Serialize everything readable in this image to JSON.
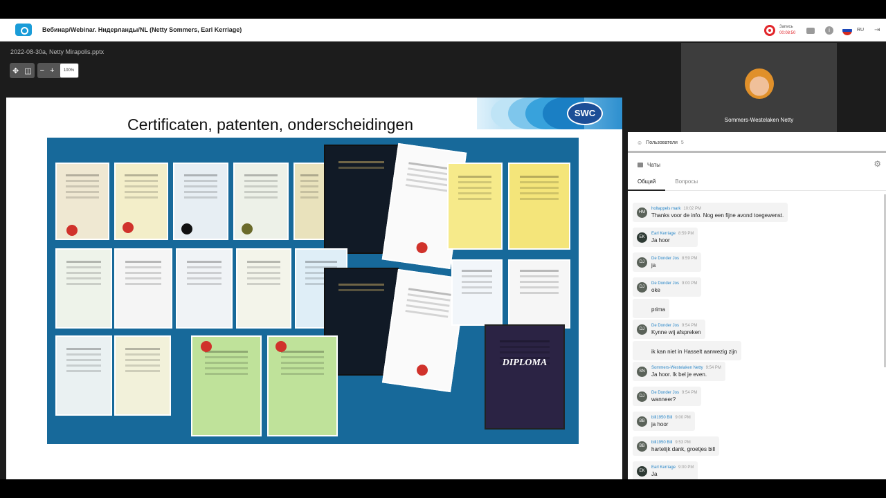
{
  "topbar": {
    "title": "Вебинар/Webinar. Нидерланды/NL (Netty Sommers, Earl Kerriage)",
    "record_label": "Запись",
    "record_time": "00:08:50",
    "language": "RU",
    "accent_color": "#1a9cd8",
    "record_color": "#e2262b",
    "icons": [
      "logo-icon",
      "record-icon",
      "folder-icon",
      "info-icon",
      "flag-ru-icon",
      "exit-icon"
    ]
  },
  "presentation": {
    "filename": "2022-08-30a, Netty Mirapolis.pptx",
    "zoom": "100%",
    "slide_title": "Certificaten, patenten, onderscheidingen",
    "logo_text": "SWC",
    "diploma_text": "DIPLOMA"
  },
  "video": {
    "participant_name": "Sommers-Westelaken Netty"
  },
  "users": {
    "label": "Пользователи",
    "count": "5"
  },
  "chats": {
    "title": "Чаты",
    "tabs": [
      "Общий",
      "Вопросы"
    ],
    "active_tab": 0,
    "messages": [
      {
        "initials": "HM",
        "author": "holtappels mark",
        "time": "10:02 PM",
        "text": "Thanks voor de info. Nog een fijne avond toegewenst."
      },
      {
        "initials": "EK",
        "author": "Earl Kerriage",
        "time": "8:59 PM",
        "text": "Ja hoor"
      },
      {
        "initials": "DJ",
        "author": "De Donder Jos",
        "time": "8:59 PM",
        "text": "ja"
      },
      {
        "initials": "DJ",
        "author": "De Donder Jos",
        "time": "9:00 PM",
        "text": "oke"
      },
      {
        "initials": "",
        "author": "",
        "time": "",
        "text": "prima"
      },
      {
        "initials": "DJ",
        "author": "De Donder Jos",
        "time": "9:54 PM",
        "text": "Kynne wij afspreken"
      },
      {
        "initials": "",
        "author": "",
        "time": "",
        "text": "ik kan niet in Hasselt aanwezig zijn"
      },
      {
        "initials": "SN",
        "author": "Sommers-Westelaken Netty",
        "time": "9:54 PM",
        "text": "Ja hoor. Ik bel je even."
      },
      {
        "initials": "DJ",
        "author": "De Donder Jos",
        "time": "9:54 PM",
        "text": "wanneer?"
      },
      {
        "initials": "BB",
        "author": "bill1950 Bill",
        "time": "9:00 PM",
        "text": "ja hoor"
      },
      {
        "initials": "BB",
        "author": "bill1950 Bill",
        "time": "9:53 PM",
        "text": "hartelijk dank, groetjes bill"
      },
      {
        "initials": "EK",
        "author": "Earl Kerriage",
        "time": "9:00 PM",
        "text": "Ja"
      }
    ]
  }
}
